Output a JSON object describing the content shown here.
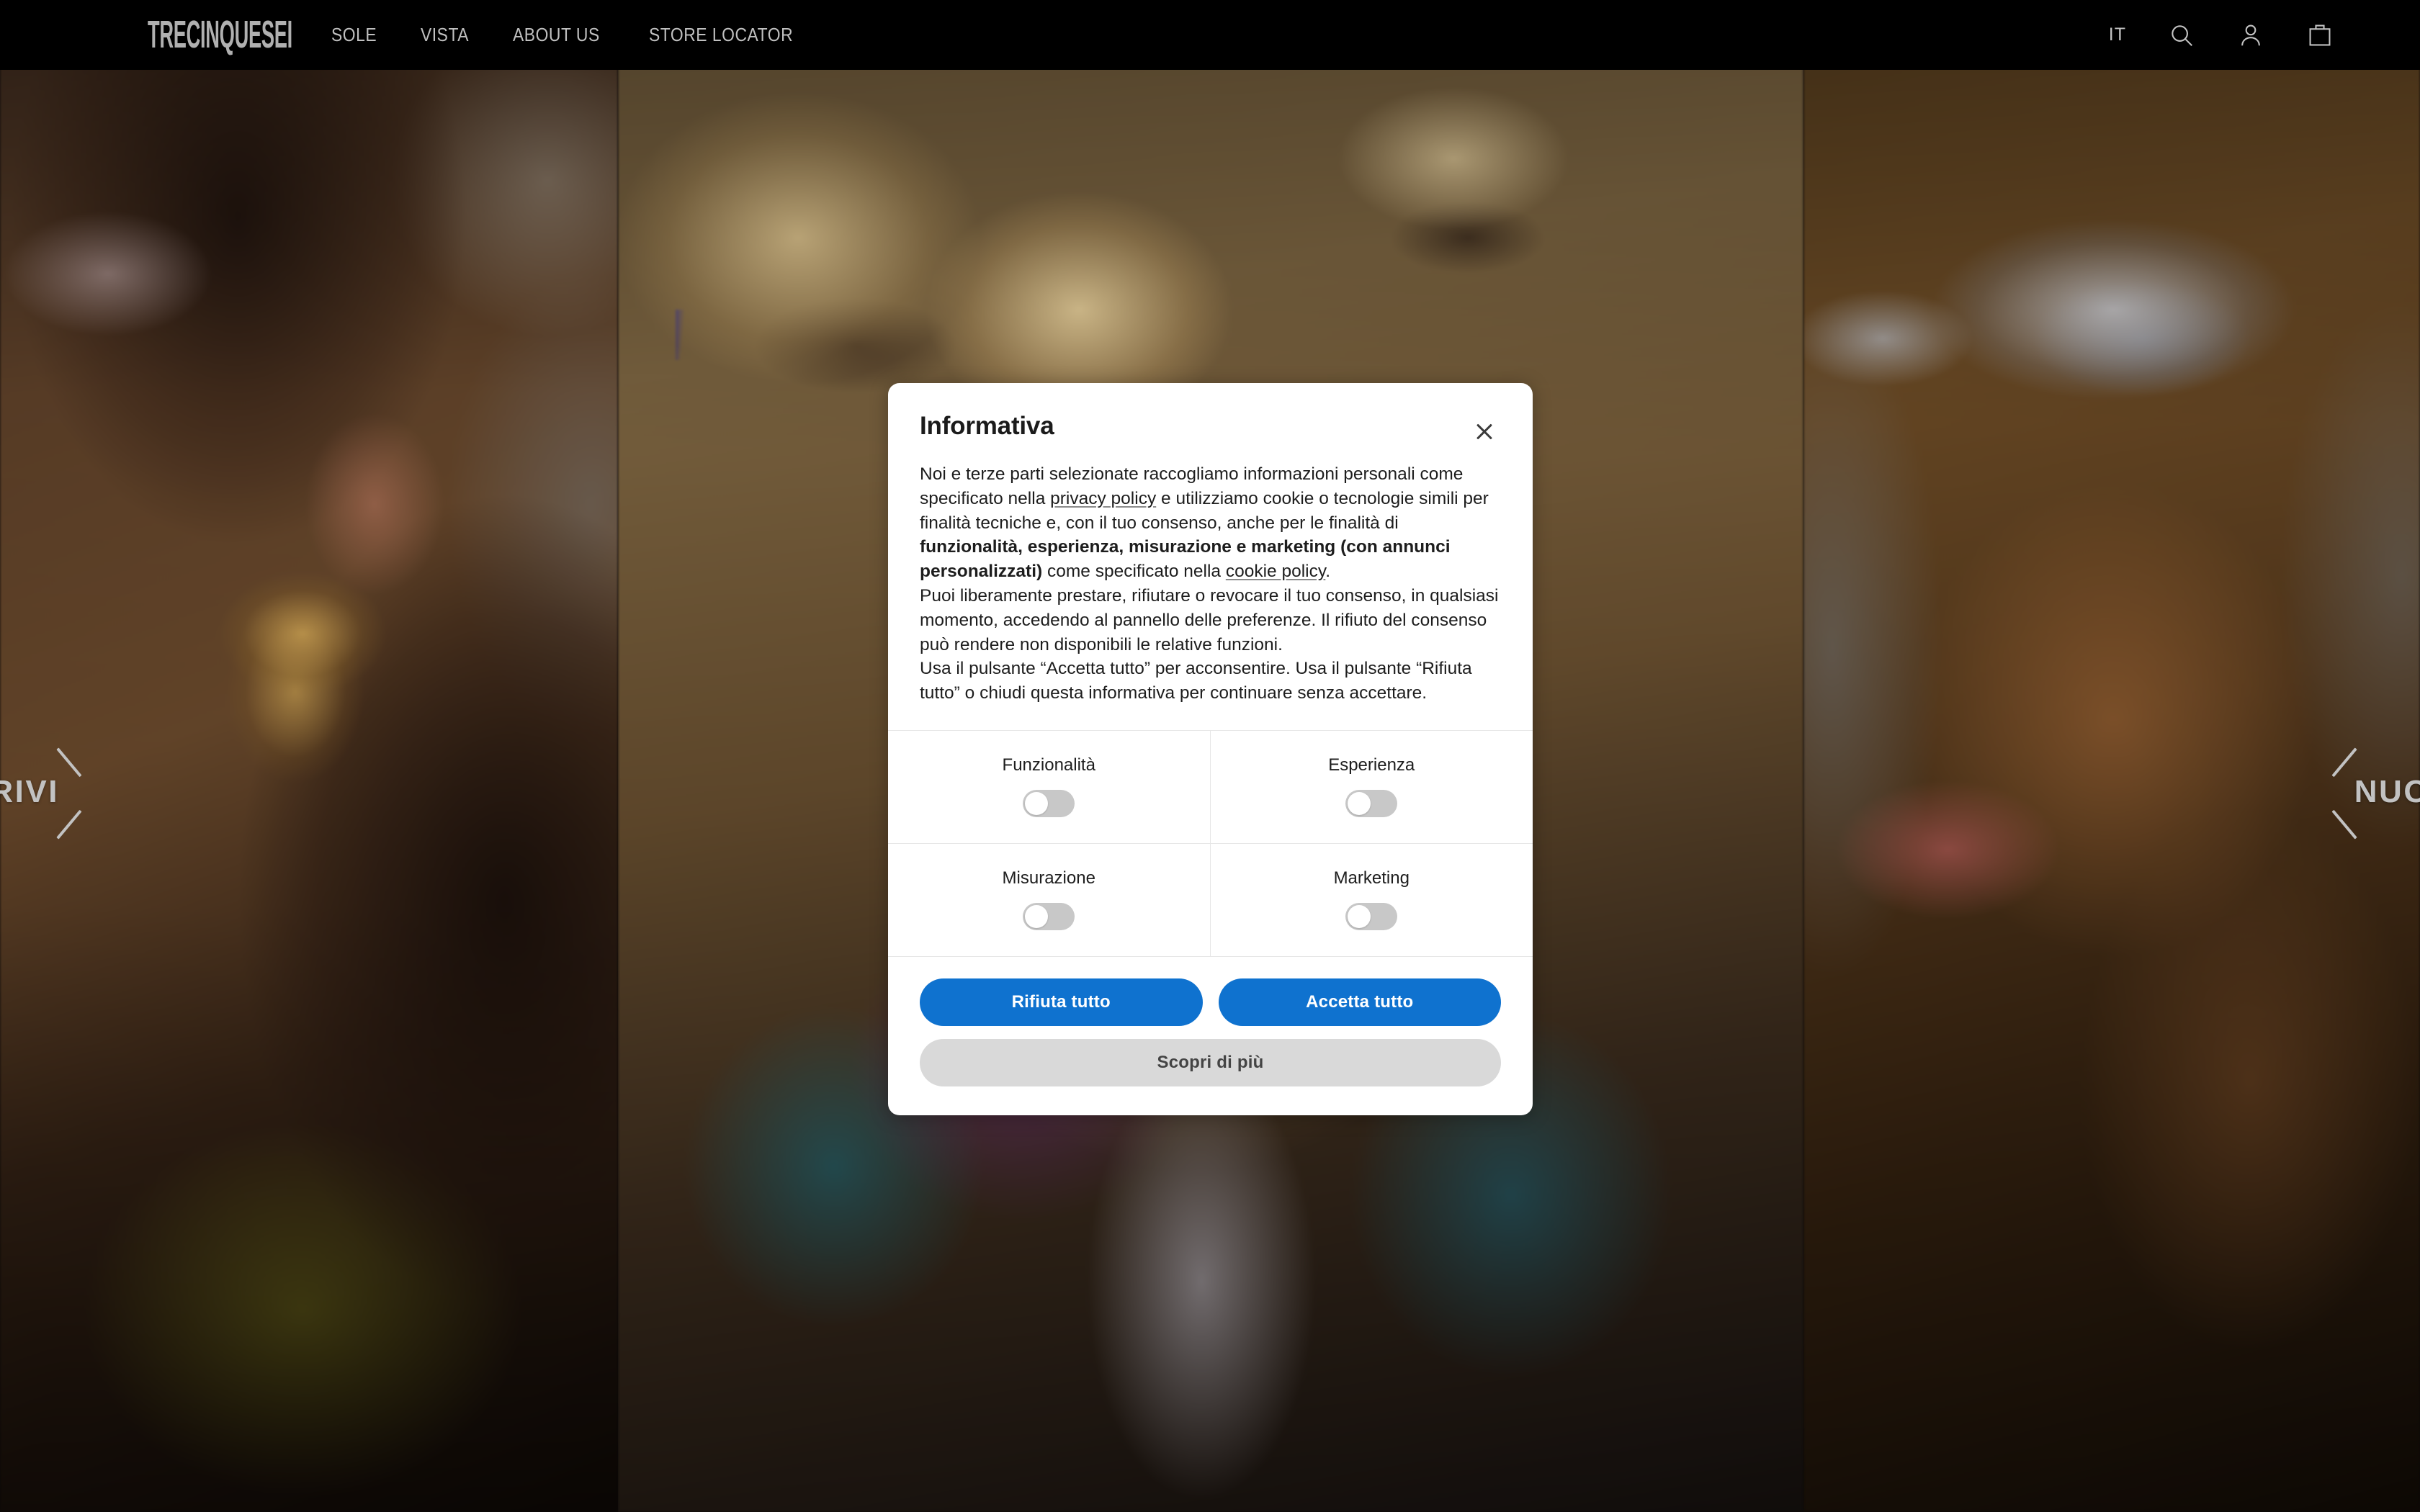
{
  "header": {
    "logo": "TRECINQUESEI",
    "nav": [
      {
        "label": "SOLE"
      },
      {
        "label": "VISTA"
      },
      {
        "label": "ABOUT US"
      },
      {
        "label": "STORE LOCATOR"
      }
    ],
    "language": "IT",
    "icons": {
      "search": "search-icon",
      "account": "user-icon",
      "cart": "shopping-bag-icon"
    }
  },
  "carousel": {
    "prev_label": "I ARRIVI",
    "prev_icon": "chevron-left-icon",
    "next_label": "NUOVI A",
    "next_icon": "chevron-right-icon"
  },
  "cookie_dialog": {
    "title": "Informativa",
    "close_icon": "close-icon",
    "paragraphs": {
      "p1_a": "Noi e terze parti selezionate raccogliamo informazioni personali come specificato nella ",
      "p1_link1": "privacy policy",
      "p1_b": " e utilizziamo cookie o tecnologie simili per finalità tecniche e, con il tuo consenso, anche per le finalità di ",
      "p1_bold": "funzionalità, esperienza, misurazione e marketing (con annunci personalizzati)",
      "p1_c": " come specificato nella ",
      "p1_link2": "cookie policy",
      "p1_d": ".",
      "p2": "Puoi liberamente prestare, rifiutare o revocare il tuo consenso, in qualsiasi momento, accedendo al pannello delle preferenze. Il rifiuto del consenso può rendere non disponibili le relative funzioni.",
      "p3": "Usa il pulsante “Accetta tutto” per acconsentire. Usa il pulsante “Rifiuta tutto” o chiudi questa informativa per continuare senza accettare."
    },
    "preferences": [
      {
        "label": "Funzionalità",
        "enabled": false
      },
      {
        "label": "Esperienza",
        "enabled": false
      },
      {
        "label": "Misurazione",
        "enabled": false
      },
      {
        "label": "Marketing",
        "enabled": false
      }
    ],
    "buttons": {
      "reject": "Rifiuta tutto",
      "accept": "Accetta tutto",
      "learn_more": "Scopri di più"
    }
  },
  "colors": {
    "primary_button": "#0f72cf",
    "secondary_button": "#d9d9d9",
    "navbar_bg": "#000000",
    "dialog_bg": "#ffffff",
    "switch_off_track": "#c8c8c8"
  }
}
